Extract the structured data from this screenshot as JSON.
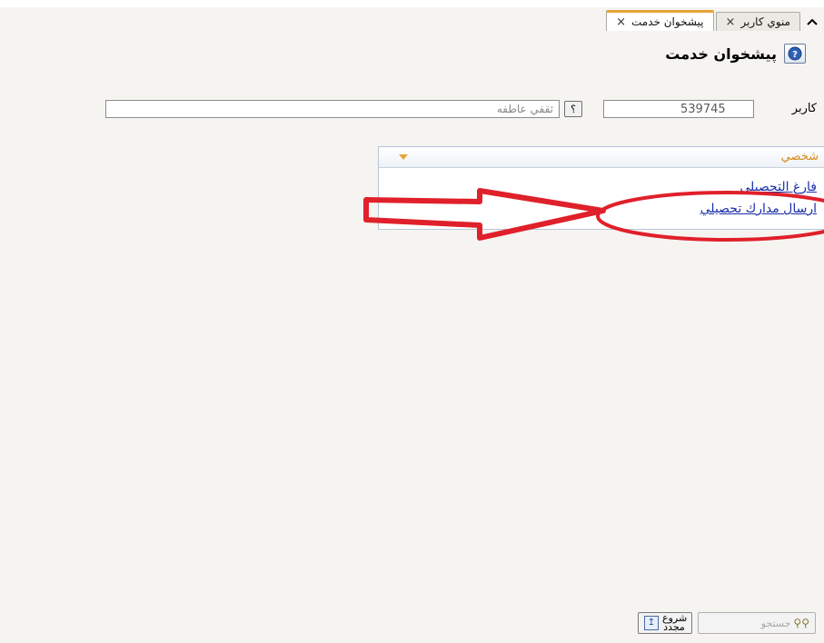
{
  "tabs": [
    {
      "label": "منوي كاربر",
      "close": "×",
      "active": false
    },
    {
      "label": "پيشخوان خدمت",
      "close": "×",
      "active": true
    }
  ],
  "page": {
    "title": "پيشخوان خدمت"
  },
  "user": {
    "label": "كاربر",
    "id_value": "539745",
    "lookup_symbol": "؟",
    "name_value": "ثقفي عاطفه"
  },
  "panel": {
    "title": "شخصي",
    "links": [
      "فارغ التحصيلي",
      "ارسال مدارك تحصيلي"
    ]
  },
  "buttons": {
    "restart_label": "شروع مجدد",
    "search_label": "جستجو"
  },
  "colors": {
    "accent": "#e8a33a",
    "link": "#1a2fa8",
    "annotation": "#e0202a"
  },
  "icons": {
    "collapse": "chevron-up-icon",
    "help": "help-icon",
    "restart": "restart-icon",
    "search": "binoculars-icon"
  }
}
